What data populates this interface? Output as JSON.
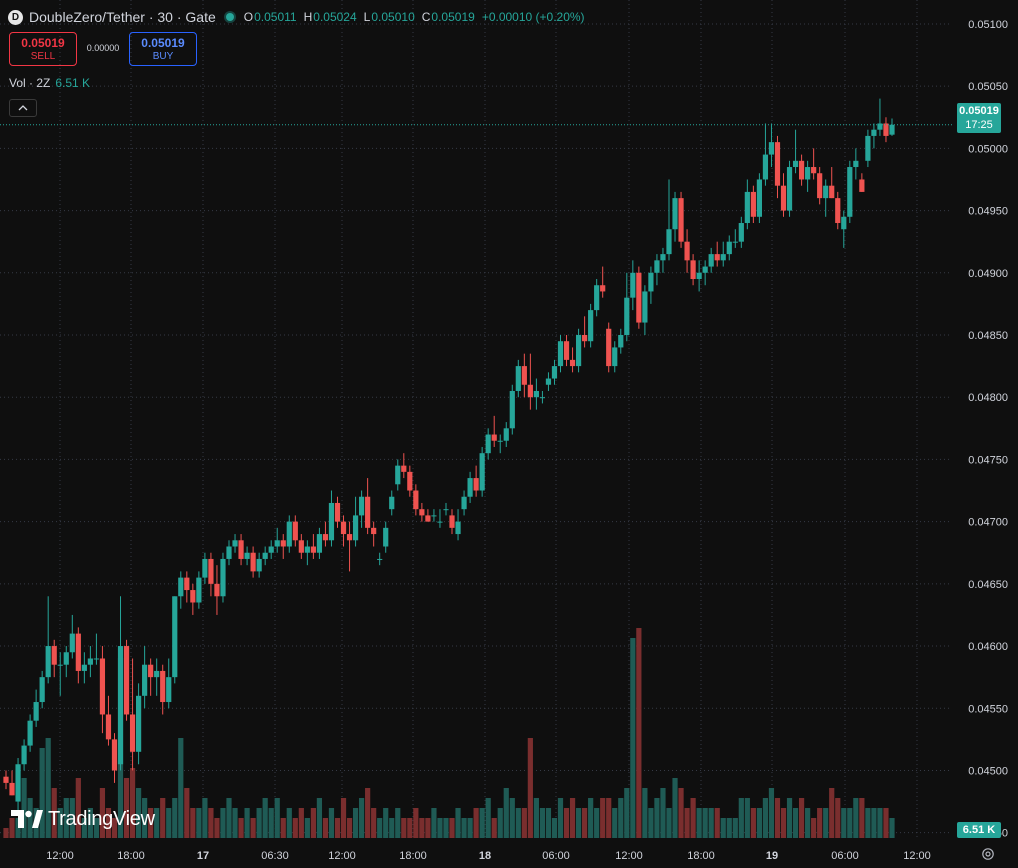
{
  "header": {
    "logo_glyph": "D",
    "title": "DoubleZero/Tether · 30 · Gate",
    "ohlc": [
      {
        "key": "O",
        "value": "0.05011"
      },
      {
        "key": "H",
        "value": "0.05024"
      },
      {
        "key": "L",
        "value": "0.05010"
      },
      {
        "key": "C",
        "value": "0.05019"
      }
    ],
    "change": "+0.00010 (+0.20%)"
  },
  "trade": {
    "sell_price": "0.05019",
    "sell_label": "SELL",
    "spread": "0.00000",
    "buy_price": "0.05019",
    "buy_label": "BUY"
  },
  "volume_legend": {
    "label": "Vol · 2Z",
    "value": "6.51 K"
  },
  "collapse_icon": "chevron-up-icon",
  "price_label": {
    "price": "0.05019",
    "countdown": "17:25"
  },
  "volume_label": "6.51 K",
  "brand": "TradingView",
  "colors": {
    "up": "#26a69a",
    "down": "#ef5350",
    "background": "#0f0f0f",
    "grid": "#363a45"
  },
  "chart_data": {
    "type": "candlestick",
    "ylim": [
      0.0442,
      0.0511
    ],
    "price_ticks": [
      "0.05100",
      "0.05050",
      "0.05000",
      "0.04950",
      "0.04900",
      "0.04850",
      "0.04800",
      "0.04750",
      "0.04700",
      "0.04650",
      "0.04600",
      "0.04550",
      "0.04500",
      "0.04450"
    ],
    "time_ticks": [
      "12:00",
      "18:00",
      "17",
      "06:30",
      "12:00",
      "18:00",
      "18",
      "06:00",
      "12:00",
      "18:00",
      "19",
      "06:00",
      "12:00"
    ],
    "last_price": 0.05019,
    "candles": [
      [
        0.04495,
        0.045,
        0.04485,
        0.0449,
        1
      ],
      [
        0.0449,
        0.045,
        0.0448,
        0.0448,
        2
      ],
      [
        0.04475,
        0.0451,
        0.04465,
        0.04505,
        2
      ],
      [
        0.04505,
        0.04525,
        0.045,
        0.0452,
        6
      ],
      [
        0.0452,
        0.04545,
        0.04515,
        0.0454,
        4
      ],
      [
        0.0454,
        0.04565,
        0.04535,
        0.04555,
        3
      ],
      [
        0.04555,
        0.0458,
        0.0455,
        0.04575,
        9
      ],
      [
        0.04575,
        0.0464,
        0.0457,
        0.046,
        10
      ],
      [
        0.046,
        0.04605,
        0.04575,
        0.04585,
        5
      ],
      [
        0.04585,
        0.04595,
        0.0456,
        0.04585,
        3
      ],
      [
        0.04585,
        0.046,
        0.04575,
        0.04595,
        4
      ],
      [
        0.04595,
        0.04625,
        0.0459,
        0.0461,
        4
      ],
      [
        0.0461,
        0.04615,
        0.0457,
        0.0458,
        6
      ],
      [
        0.0458,
        0.04595,
        0.0457,
        0.04585,
        2
      ],
      [
        0.04585,
        0.046,
        0.04575,
        0.0459,
        3
      ],
      [
        0.0459,
        0.0461,
        0.04585,
        0.0459,
        2
      ],
      [
        0.0459,
        0.046,
        0.0453,
        0.04545,
        5
      ],
      [
        0.04545,
        0.0456,
        0.0452,
        0.04525,
        3
      ],
      [
        0.04525,
        0.0453,
        0.0449,
        0.045,
        2
      ],
      [
        0.04505,
        0.0464,
        0.045,
        0.046,
        18
      ],
      [
        0.046,
        0.04605,
        0.0454,
        0.04545,
        6
      ],
      [
        0.04545,
        0.0459,
        0.045,
        0.04515,
        7
      ],
      [
        0.04515,
        0.0457,
        0.04505,
        0.0456,
        5
      ],
      [
        0.0456,
        0.046,
        0.0455,
        0.04585,
        4
      ],
      [
        0.04585,
        0.0459,
        0.0456,
        0.04575,
        3
      ],
      [
        0.04575,
        0.0459,
        0.0456,
        0.0458,
        3
      ],
      [
        0.0458,
        0.04585,
        0.04545,
        0.04555,
        4
      ],
      [
        0.04555,
        0.0459,
        0.0455,
        0.04575,
        3
      ],
      [
        0.04575,
        0.0464,
        0.0457,
        0.0464,
        4
      ],
      [
        0.0464,
        0.0466,
        0.0463,
        0.04655,
        10
      ],
      [
        0.04655,
        0.0466,
        0.04635,
        0.04645,
        5
      ],
      [
        0.04645,
        0.0465,
        0.04625,
        0.04635,
        3
      ],
      [
        0.04635,
        0.0466,
        0.0463,
        0.04655,
        3
      ],
      [
        0.04655,
        0.04675,
        0.0465,
        0.0467,
        4
      ],
      [
        0.0467,
        0.04675,
        0.0464,
        0.0465,
        3
      ],
      [
        0.0465,
        0.04665,
        0.04625,
        0.0464,
        2
      ],
      [
        0.0464,
        0.04675,
        0.04635,
        0.0467,
        3
      ],
      [
        0.0467,
        0.04685,
        0.04665,
        0.0468,
        4
      ],
      [
        0.0468,
        0.0469,
        0.04675,
        0.04685,
        3
      ],
      [
        0.04685,
        0.0469,
        0.04665,
        0.0467,
        2
      ],
      [
        0.0467,
        0.0468,
        0.04665,
        0.04675,
        3
      ],
      [
        0.04675,
        0.0468,
        0.04655,
        0.0466,
        2
      ],
      [
        0.0466,
        0.04675,
        0.04655,
        0.0467,
        3
      ],
      [
        0.0467,
        0.0468,
        0.04665,
        0.04675,
        4
      ],
      [
        0.04675,
        0.04685,
        0.0467,
        0.0468,
        3
      ],
      [
        0.0468,
        0.04695,
        0.04675,
        0.04685,
        4
      ],
      [
        0.04685,
        0.0469,
        0.0467,
        0.0468,
        2
      ],
      [
        0.0468,
        0.04705,
        0.04675,
        0.047,
        3
      ],
      [
        0.047,
        0.04705,
        0.0468,
        0.04685,
        2
      ],
      [
        0.04685,
        0.0469,
        0.0467,
        0.04675,
        3
      ],
      [
        0.04675,
        0.04685,
        0.04665,
        0.0468,
        2
      ],
      [
        0.0468,
        0.0469,
        0.0467,
        0.04675,
        3
      ],
      [
        0.04675,
        0.04695,
        0.0467,
        0.0469,
        4
      ],
      [
        0.0469,
        0.047,
        0.0468,
        0.04685,
        2
      ],
      [
        0.04685,
        0.04725,
        0.0468,
        0.04715,
        3
      ],
      [
        0.04715,
        0.0472,
        0.04695,
        0.047,
        2
      ],
      [
        0.047,
        0.04705,
        0.0468,
        0.0469,
        4
      ],
      [
        0.0469,
        0.047,
        0.0466,
        0.04685,
        2
      ],
      [
        0.04685,
        0.0472,
        0.0468,
        0.04705,
        3
      ],
      [
        0.04705,
        0.04725,
        0.04695,
        0.0472,
        4
      ],
      [
        0.0472,
        0.04735,
        0.0469,
        0.04695,
        5
      ],
      [
        0.04695,
        0.047,
        0.0468,
        0.0469,
        3
      ],
      [
        0.0467,
        0.04675,
        0.04665,
        0.0467,
        2
      ],
      [
        0.0468,
        0.047,
        0.04675,
        0.04695,
        3
      ],
      [
        0.0471,
        0.04725,
        0.04705,
        0.0472,
        2
      ],
      [
        0.0473,
        0.0475,
        0.04725,
        0.04745,
        3
      ],
      [
        0.04745,
        0.04755,
        0.04735,
        0.0474,
        2
      ],
      [
        0.0474,
        0.04745,
        0.0472,
        0.04725,
        2
      ],
      [
        0.04725,
        0.0473,
        0.04705,
        0.0471,
        3
      ],
      [
        0.0471,
        0.04715,
        0.047,
        0.04705,
        2
      ],
      [
        0.04705,
        0.0471,
        0.047,
        0.047,
        2
      ],
      [
        0.04705,
        0.0471,
        0.047,
        0.04705,
        3
      ],
      [
        0.047,
        0.0471,
        0.04695,
        0.047,
        2
      ],
      [
        0.0471,
        0.04715,
        0.04705,
        0.0471,
        2
      ],
      [
        0.04705,
        0.0471,
        0.0469,
        0.04695,
        2
      ],
      [
        0.0469,
        0.0471,
        0.04685,
        0.047,
        3
      ],
      [
        0.0471,
        0.04725,
        0.04705,
        0.0472,
        2
      ],
      [
        0.0472,
        0.0474,
        0.04715,
        0.04735,
        2
      ],
      [
        0.04735,
        0.04745,
        0.0472,
        0.04725,
        3
      ],
      [
        0.04725,
        0.0476,
        0.0472,
        0.04755,
        3
      ],
      [
        0.04755,
        0.04775,
        0.0475,
        0.0477,
        4
      ],
      [
        0.0477,
        0.04785,
        0.0476,
        0.04765,
        2
      ],
      [
        0.04765,
        0.0477,
        0.04755,
        0.04765,
        3
      ],
      [
        0.04765,
        0.0478,
        0.0476,
        0.04775,
        5
      ],
      [
        0.04775,
        0.0481,
        0.0477,
        0.04805,
        4
      ],
      [
        0.04805,
        0.0483,
        0.048,
        0.04825,
        3
      ],
      [
        0.04825,
        0.04835,
        0.048,
        0.0481,
        3
      ],
      [
        0.0481,
        0.04835,
        0.0479,
        0.048,
        10
      ],
      [
        0.048,
        0.04815,
        0.0479,
        0.04805,
        4
      ],
      [
        0.048,
        0.04805,
        0.04795,
        0.048,
        3
      ],
      [
        0.0481,
        0.0482,
        0.04805,
        0.04815,
        3
      ],
      [
        0.04815,
        0.0483,
        0.0481,
        0.04825,
        2
      ],
      [
        0.04825,
        0.0485,
        0.0482,
        0.04845,
        4
      ],
      [
        0.04845,
        0.0485,
        0.04825,
        0.0483,
        3
      ],
      [
        0.0483,
        0.0484,
        0.0482,
        0.04825,
        4
      ],
      [
        0.04825,
        0.04855,
        0.0482,
        0.0485,
        3
      ],
      [
        0.0485,
        0.04865,
        0.0484,
        0.04845,
        3
      ],
      [
        0.04845,
        0.04875,
        0.0484,
        0.0487,
        4
      ],
      [
        0.0487,
        0.04895,
        0.04865,
        0.0489,
        3
      ],
      [
        0.0489,
        0.04905,
        0.0488,
        0.04885,
        4
      ],
      [
        0.04855,
        0.0486,
        0.0482,
        0.04825,
        4
      ],
      [
        0.04825,
        0.04845,
        0.0482,
        0.0484,
        3
      ],
      [
        0.0484,
        0.04855,
        0.04835,
        0.0485,
        4
      ],
      [
        0.0485,
        0.049,
        0.04845,
        0.0488,
        5
      ],
      [
        0.0488,
        0.0491,
        0.0487,
        0.049,
        20
      ],
      [
        0.049,
        0.04905,
        0.04855,
        0.0486,
        21
      ],
      [
        0.0486,
        0.0489,
        0.0485,
        0.04885,
        5
      ],
      [
        0.04885,
        0.04905,
        0.04875,
        0.049,
        3
      ],
      [
        0.049,
        0.04915,
        0.0489,
        0.0491,
        4
      ],
      [
        0.0491,
        0.0492,
        0.049,
        0.04915,
        5
      ],
      [
        0.04915,
        0.04975,
        0.0491,
        0.04935,
        3
      ],
      [
        0.04935,
        0.04965,
        0.04925,
        0.0496,
        6
      ],
      [
        0.0496,
        0.04965,
        0.0492,
        0.04925,
        5
      ],
      [
        0.04925,
        0.04935,
        0.049,
        0.0491,
        3
      ],
      [
        0.0491,
        0.04915,
        0.0489,
        0.04895,
        4
      ],
      [
        0.04895,
        0.0491,
        0.04885,
        0.049,
        3
      ],
      [
        0.049,
        0.0491,
        0.0489,
        0.04905,
        3
      ],
      [
        0.04905,
        0.0492,
        0.049,
        0.04915,
        3
      ],
      [
        0.04915,
        0.04925,
        0.04905,
        0.0491,
        3
      ],
      [
        0.0491,
        0.04925,
        0.04905,
        0.04915,
        2
      ],
      [
        0.04915,
        0.0493,
        0.0491,
        0.04925,
        2
      ],
      [
        0.04925,
        0.04935,
        0.0492,
        0.04925,
        2
      ],
      [
        0.04925,
        0.04945,
        0.0492,
        0.0494,
        4
      ],
      [
        0.0494,
        0.04975,
        0.04935,
        0.04965,
        4
      ],
      [
        0.04965,
        0.0497,
        0.0494,
        0.04945,
        3
      ],
      [
        0.04945,
        0.0498,
        0.0494,
        0.04975,
        3
      ],
      [
        0.04975,
        0.0502,
        0.0497,
        0.04995,
        4
      ],
      [
        0.04995,
        0.0502,
        0.04985,
        0.05005,
        5
      ],
      [
        0.05005,
        0.0501,
        0.0496,
        0.0497,
        4
      ],
      [
        0.0497,
        0.0498,
        0.04945,
        0.0495,
        3
      ],
      [
        0.0495,
        0.0499,
        0.04945,
        0.04985,
        4
      ],
      [
        0.04985,
        0.05015,
        0.0498,
        0.0499,
        3
      ],
      [
        0.0499,
        0.04995,
        0.0497,
        0.04975,
        4
      ],
      [
        0.04975,
        0.0499,
        0.04965,
        0.04985,
        3
      ],
      [
        0.04985,
        0.05,
        0.04975,
        0.0498,
        2
      ],
      [
        0.0498,
        0.04985,
        0.04955,
        0.0496,
        3
      ],
      [
        0.0496,
        0.04975,
        0.04945,
        0.0497,
        3
      ],
      [
        0.0497,
        0.04985,
        0.0496,
        0.0496,
        5
      ],
      [
        0.0496,
        0.04965,
        0.04935,
        0.0494,
        4
      ],
      [
        0.04935,
        0.0495,
        0.0492,
        0.04945,
        3
      ],
      [
        0.04945,
        0.0499,
        0.0494,
        0.04985,
        3
      ],
      [
        0.04985,
        0.05,
        0.04975,
        0.0499,
        4
      ],
      [
        0.04975,
        0.0498,
        0.04965,
        0.04965,
        4
      ],
      [
        0.0499,
        0.05015,
        0.04985,
        0.0501,
        3
      ],
      [
        0.0501,
        0.0502,
        0.05,
        0.05015,
        3
      ],
      [
        0.05015,
        0.0504,
        0.0501,
        0.0502,
        3
      ],
      [
        0.0502,
        0.05025,
        0.05005,
        0.0501,
        3
      ],
      [
        0.05011,
        0.05024,
        0.0501,
        0.05019,
        2
      ]
    ]
  }
}
